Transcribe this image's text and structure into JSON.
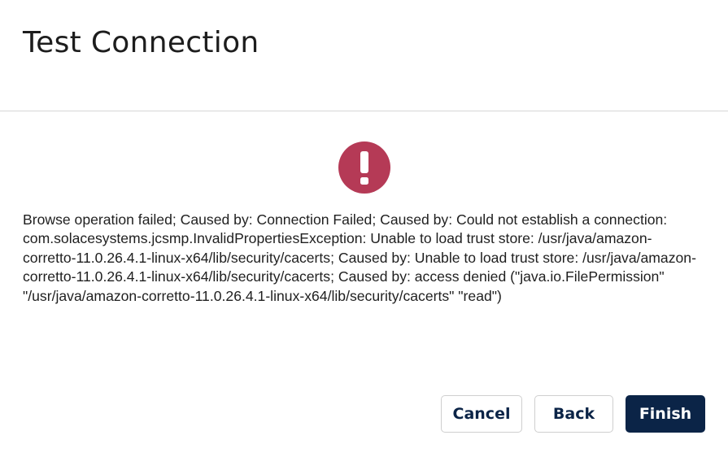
{
  "dialog": {
    "title": "Test Connection",
    "icon": "exclamation-circle-icon",
    "icon_color": "#b53a56",
    "message": "Browse operation failed; Caused by: Connection Failed; Caused by: Could not establish a connection: com.solacesystems.jcsmp.InvalidPropertiesException: Unable to load trust store: /usr/java/amazon-corretto-11.0.26.4.1-linux-x64/lib/security/cacerts; Caused by: Unable to load trust store: /usr/java/amazon-corretto-11.0.26.4.1-linux-x64/lib/security/cacerts; Caused by: access denied (\"java.io.FilePermission\" \"/usr/java/amazon-corretto-11.0.26.4.1-linux-x64/lib/security/cacerts\" \"read\")"
  },
  "footer": {
    "cancel_label": "Cancel",
    "back_label": "Back",
    "finish_label": "Finish"
  },
  "colors": {
    "primary": "#0b2447",
    "error": "#b53a56",
    "divider": "#d6d6d6"
  }
}
